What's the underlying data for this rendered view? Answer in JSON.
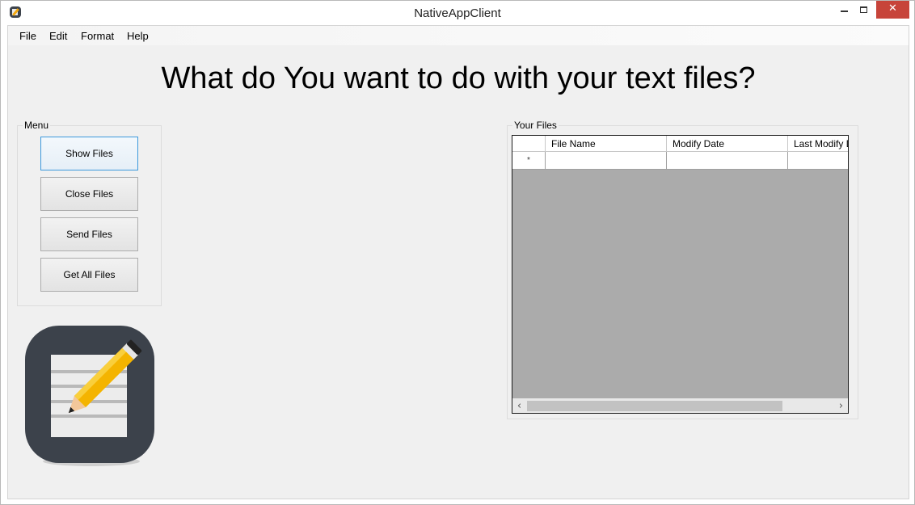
{
  "window": {
    "title": "NativeAppClient"
  },
  "menubar": {
    "items": [
      "File",
      "Edit",
      "Format",
      "Help"
    ]
  },
  "headline": "What do You want to do with your text files?",
  "menu_group": {
    "label": "Menu",
    "buttons": [
      "Show Files",
      "Close Files",
      "Send Files",
      "Get All Files"
    ]
  },
  "files_group": {
    "label": "Your Files",
    "columns": [
      "File Name",
      "Modify Date",
      "Last Modify Da"
    ],
    "new_row_marker": "*"
  },
  "icons": {
    "app": "notepad-pencil-icon",
    "logo": "notepad-pencil-logo",
    "scroll_left": "chevron-left-icon",
    "scroll_right": "chevron-right-icon"
  },
  "colors": {
    "close_button": "#c7443a",
    "focus_border": "#3c99dc",
    "grid_background": "#ababab",
    "client_background": "#f0f0f0"
  }
}
